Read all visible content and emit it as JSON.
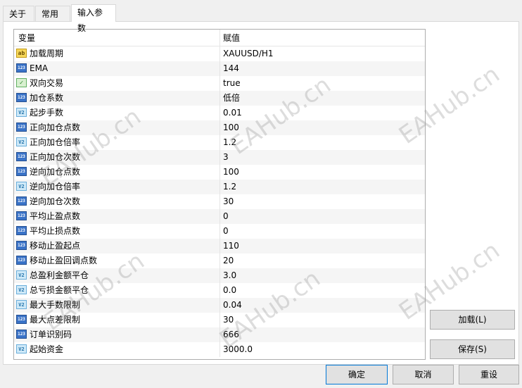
{
  "tabs": [
    {
      "label": "关于"
    },
    {
      "label": "常用"
    },
    {
      "label": "输入参数"
    }
  ],
  "table": {
    "headers": {
      "name": "变量",
      "value": "赋值"
    },
    "rows": [
      {
        "icon": "string",
        "name": "加载周期",
        "value": "XAUUSD/H1"
      },
      {
        "icon": "int",
        "name": "EMA",
        "value": "144"
      },
      {
        "icon": "bool",
        "name": "双向交易",
        "value": "true"
      },
      {
        "icon": "int",
        "name": "加仓系数",
        "value": "低倍"
      },
      {
        "icon": "double",
        "name": "起步手数",
        "value": "0.01"
      },
      {
        "icon": "int",
        "name": "正向加仓点数",
        "value": "100"
      },
      {
        "icon": "double",
        "name": "正向加仓倍率",
        "value": "1.2"
      },
      {
        "icon": "int",
        "name": "正向加仓次数",
        "value": "3"
      },
      {
        "icon": "int",
        "name": "逆向加仓点数",
        "value": "100"
      },
      {
        "icon": "double",
        "name": "逆向加仓倍率",
        "value": "1.2"
      },
      {
        "icon": "int",
        "name": "逆向加仓次数",
        "value": "30"
      },
      {
        "icon": "int",
        "name": "平均止盈点数",
        "value": "0"
      },
      {
        "icon": "int",
        "name": "平均止损点数",
        "value": "0"
      },
      {
        "icon": "int",
        "name": "移动止盈起点",
        "value": "110"
      },
      {
        "icon": "int",
        "name": "移动止盈回调点数",
        "value": "20"
      },
      {
        "icon": "double",
        "name": "总盈利金额平仓",
        "value": "3.0"
      },
      {
        "icon": "double",
        "name": "总亏损金额平仓",
        "value": "0.0"
      },
      {
        "icon": "double",
        "name": "最大手数限制",
        "value": "0.04"
      },
      {
        "icon": "int",
        "name": "最大点差限制",
        "value": "30"
      },
      {
        "icon": "int",
        "name": "订单识别码",
        "value": "666"
      },
      {
        "icon": "double",
        "name": "起始资金",
        "value": "3000.0"
      }
    ]
  },
  "icons": {
    "string": "ab",
    "int": "123",
    "double": "V2",
    "bool": "✓"
  },
  "side_buttons": {
    "load": "加载(L)",
    "save": "保存(S)"
  },
  "footer_buttons": {
    "ok": "确定",
    "cancel": "取消",
    "reset": "重设"
  },
  "watermark": "EAHub.cn"
}
